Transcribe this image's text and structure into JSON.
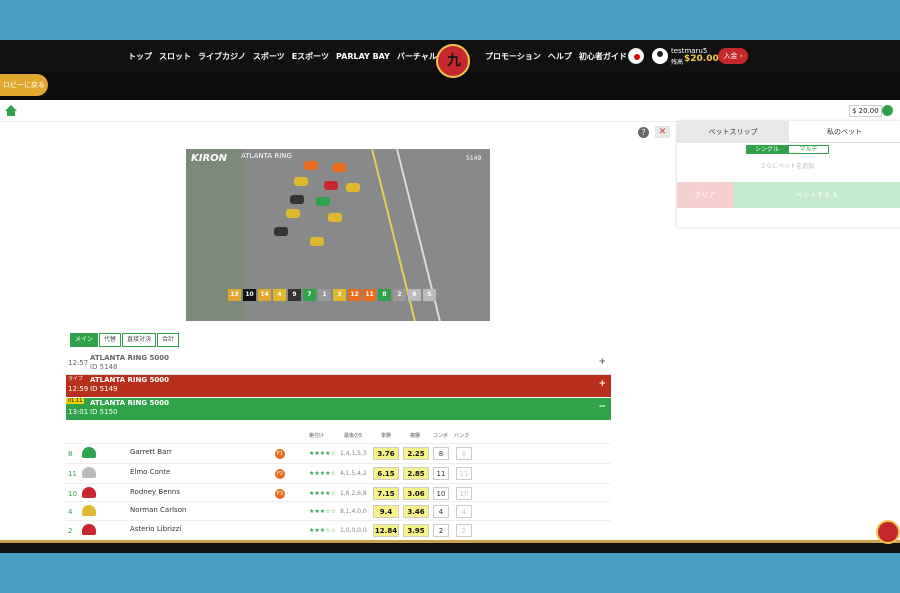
{
  "header": {
    "nav_left": [
      "トップ",
      "スロット",
      "ライブカジノ",
      "スポーツ",
      "Eスポーツ",
      "PARLAY BAY",
      "バーチャル"
    ],
    "nav_right": [
      "プロモーション",
      "ヘルプ",
      "初心者ガイド"
    ],
    "username": "testmaru5",
    "balance_label": "残高",
    "balance": "$20.00",
    "deposit_label": "入金",
    "lobby_label": "ロビーに戻る"
  },
  "toolbar": {
    "wallet": "$ 20.00"
  },
  "betslip": {
    "tabs": [
      "ベットスリップ",
      "私のベット"
    ],
    "toggle": [
      "シングル",
      "マルチ"
    ],
    "hint": "さらにベットを追加",
    "clear_label": "クリア",
    "bet_label": "ベットする"
  },
  "video": {
    "brand": "KIRON",
    "title": "ATLANTA RING",
    "race_id": "5149",
    "positions": [
      "13",
      "10",
      "14",
      "4",
      "9",
      "7",
      "1",
      "3",
      "12",
      "11",
      "8",
      "2",
      "6",
      "5"
    ]
  },
  "market_tabs": [
    "メイン",
    "代替",
    "直接対決",
    "合計"
  ],
  "races": [
    {
      "time": "12:57",
      "name": "ATLANTA RING 5000",
      "id": "ID 5148",
      "badge": "",
      "sign": "+"
    },
    {
      "time": "12:59",
      "name": "ATLANTA RING 5000",
      "id": "ID 5149",
      "badge": "ライブ",
      "sign": "+"
    },
    {
      "time": "13:01",
      "name": "ATLANTA RING 5000",
      "id": "ID 5150",
      "badge": "01:11",
      "sign": "−"
    }
  ],
  "runner_headers": {
    "rating": "格付け",
    "last5": "最後の5",
    "win": "単勝",
    "place": "複勝",
    "combo": "コンボ",
    "bank": "バンク"
  },
  "runners": [
    {
      "num": "8",
      "name": "Garrett Barr",
      "form": "F1",
      "stars": "★★★★☆",
      "last5": "1,4,1,5,3",
      "win": "3.76",
      "place": "2.25",
      "combo": "8",
      "bank": "8",
      "helmet": "#2fa24a"
    },
    {
      "num": "11",
      "name": "Elmo Conte",
      "form": "F2",
      "stars": "★★★★☆",
      "last5": "4,1,5,4,2",
      "win": "6.15",
      "place": "2.85",
      "combo": "11",
      "bank": "11",
      "helmet": "#bbbbbb"
    },
    {
      "num": "10",
      "name": "Rodney Benns",
      "form": "F3",
      "stars": "★★★★☆",
      "last5": "1,6,2,6,8",
      "win": "7.15",
      "place": "3.06",
      "combo": "10",
      "bank": "10",
      "helmet": "#c7282d"
    },
    {
      "num": "4",
      "name": "Norman Carlson",
      "form": "",
      "stars": "★★★☆☆",
      "last5": "8,1,4,0,0",
      "win": "9.4",
      "place": "3.46",
      "combo": "4",
      "bank": "4",
      "helmet": "#e0b82e"
    },
    {
      "num": "2",
      "name": "Asterio Librizzi",
      "form": "",
      "stars": "★★★☆☆",
      "last5": "1,0,0,0,0",
      "win": "12.84",
      "place": "3.95",
      "combo": "2",
      "bank": "2",
      "helmet": "#c7282d"
    }
  ]
}
